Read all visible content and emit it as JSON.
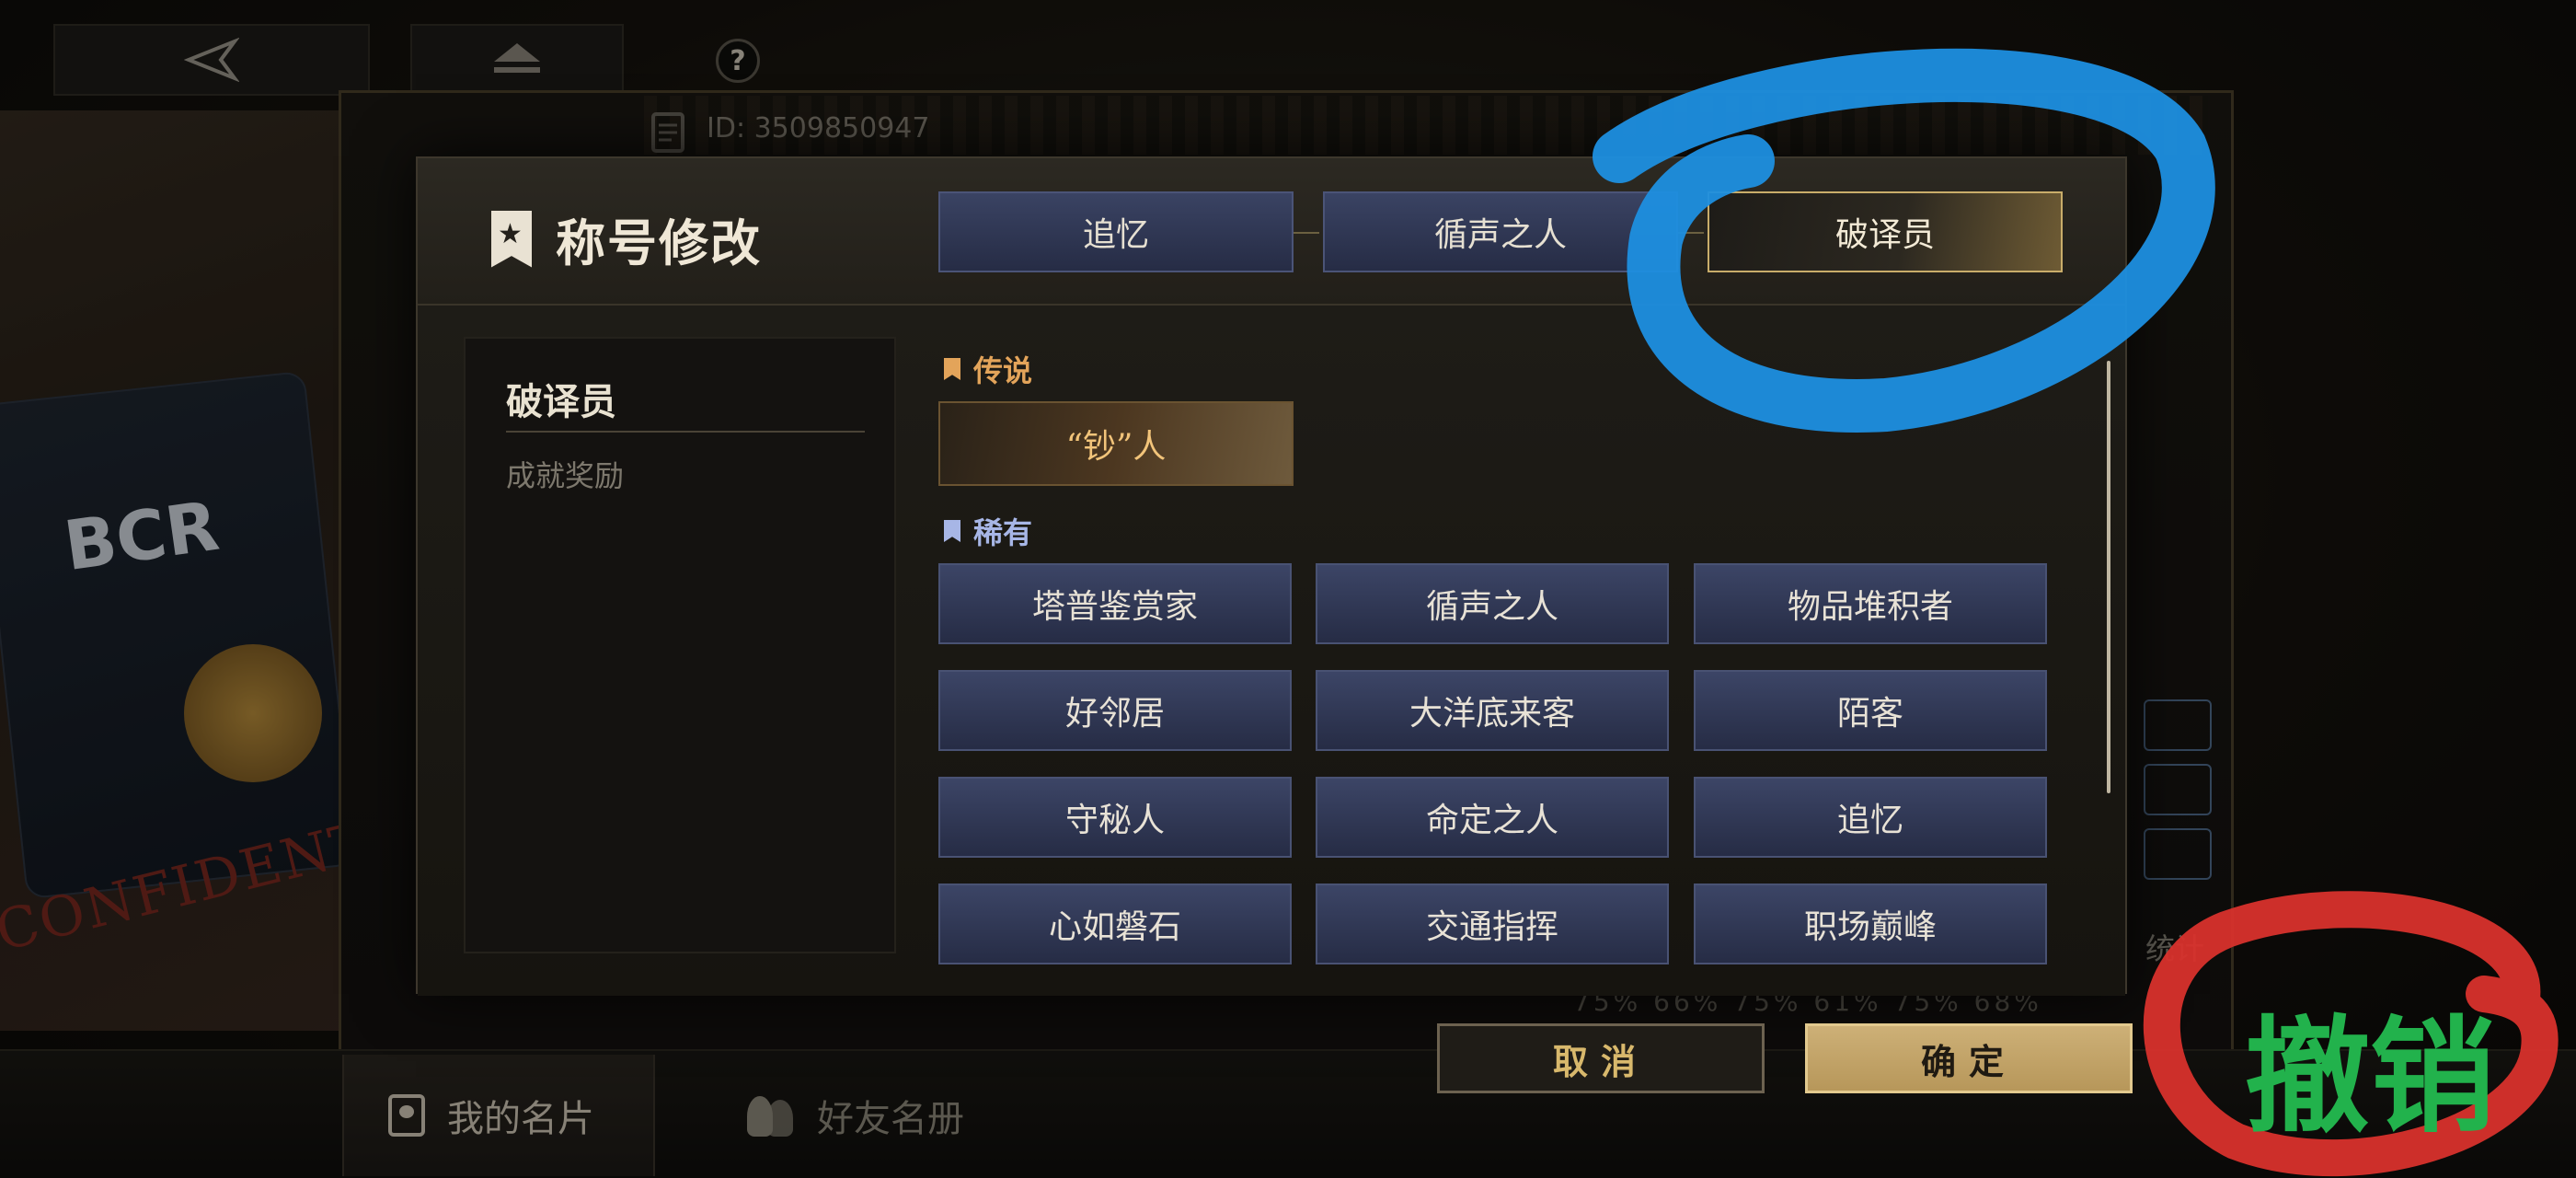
{
  "top_bar": {
    "back_icon": "back-arrow-icon",
    "eject_icon": "eject-icon",
    "help_label": "?"
  },
  "card": {
    "player_id": "ID: 3509850947",
    "stat_label": "统计",
    "percent_row": "75%  66%  75%  61%  75%  68%"
  },
  "dialog": {
    "title": "称号修改",
    "tabs": [
      {
        "label": "追忆",
        "selected": false
      },
      {
        "label": "循声之人",
        "selected": false
      },
      {
        "label": "破译员",
        "selected": true
      }
    ],
    "side_panel": {
      "title": "破译员",
      "subtitle": "成就奖励"
    },
    "sections": {
      "legend": {
        "label": "传说",
        "items": [
          "“钞”人"
        ]
      },
      "rare": {
        "label": "稀有",
        "items": [
          "塔普鉴赏家",
          "循声之人",
          "物品堆积者",
          "好邻居",
          "大洋底来客",
          "陌客",
          "守秘人",
          "命定之人",
          "追忆",
          "心如磐石",
          "交通指挥",
          "职场巅峰"
        ]
      }
    },
    "cancel_label": "取消",
    "confirm_label": "确定"
  },
  "bottom_nav": {
    "tabs": [
      {
        "label": "我的名片",
        "active": true
      },
      {
        "label": "好友名册",
        "active": false
      }
    ]
  },
  "annotation": {
    "handwritten_text": "撤销",
    "blue_circle_color": "#1e8fe0",
    "red_circle_color": "#d8312c",
    "text_color": "#22b24c"
  },
  "colors": {
    "tab_blue": "#2f3655",
    "gold": "#c9ad6a",
    "legend_orange": "#e3a45a",
    "rare_blue": "#a7b6e6"
  }
}
